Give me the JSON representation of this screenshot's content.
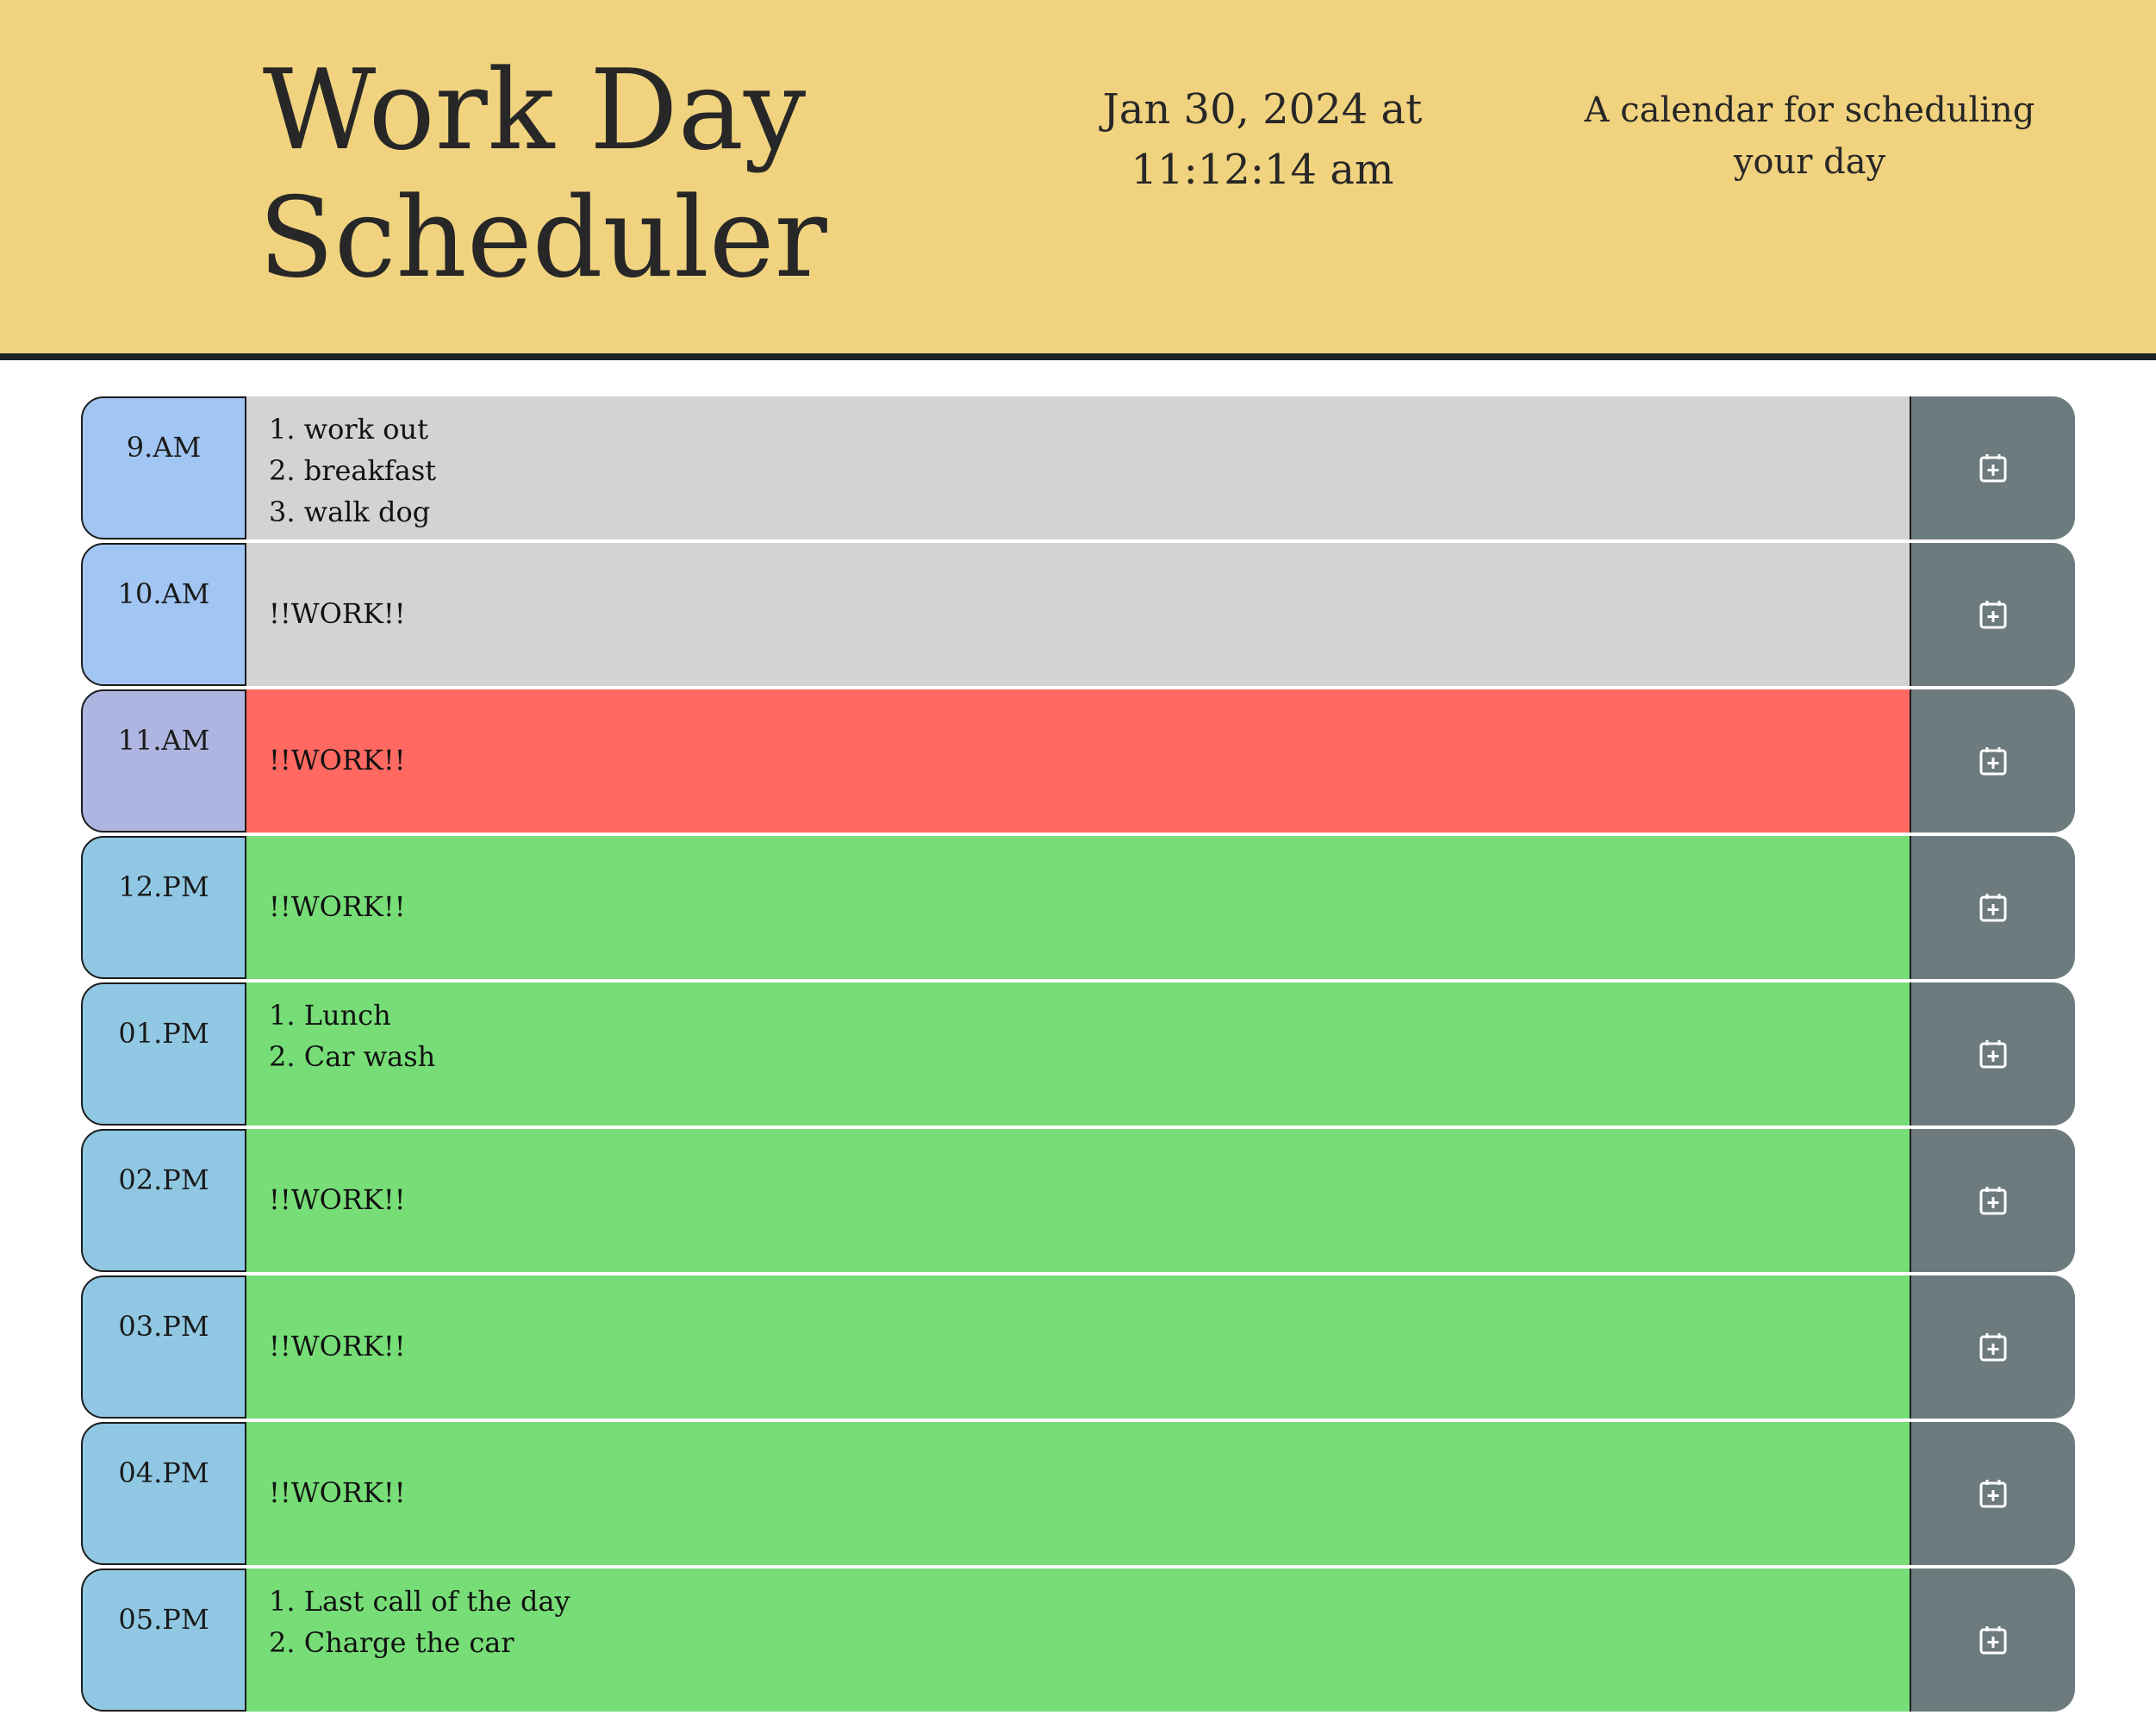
{
  "header": {
    "title": "Work Day Scheduler",
    "datetime": "Jan 30, 2024 at 11:12:14 am",
    "lead": "A calendar for scheduling your day"
  },
  "colors": {
    "header_bg": "#f1d37f",
    "past": "#d3d3d3",
    "present": "#ff6961",
    "future": "#77dd77",
    "save_button": "#6d7b7e"
  },
  "rows": [
    {
      "hour": "9.AM",
      "text": "1. work out\n2. breakfast\n3. walk dog",
      "state": "past",
      "save_icon": "calendar-plus-icon"
    },
    {
      "hour": "10.AM",
      "text": "!!WORK!!",
      "state": "past",
      "save_icon": "calendar-plus-icon"
    },
    {
      "hour": "11.AM",
      "text": "!!WORK!!",
      "state": "present",
      "save_icon": "calendar-plus-icon"
    },
    {
      "hour": "12.PM",
      "text": "!!WORK!!",
      "state": "future",
      "save_icon": "calendar-plus-icon"
    },
    {
      "hour": "01.PM",
      "text": "1. Lunch\n2. Car wash",
      "state": "future",
      "save_icon": "calendar-plus-icon"
    },
    {
      "hour": "02.PM",
      "text": "!!WORK!!",
      "state": "future",
      "save_icon": "calendar-plus-icon"
    },
    {
      "hour": "03.PM",
      "text": "!!WORK!!",
      "state": "future",
      "save_icon": "calendar-plus-icon"
    },
    {
      "hour": "04.PM",
      "text": "!!WORK!!",
      "state": "future",
      "save_icon": "calendar-plus-icon"
    },
    {
      "hour": "05.PM",
      "text": "1. Last call of the day\n2. Charge the car",
      "state": "future",
      "save_icon": "calendar-plus-icon"
    }
  ]
}
